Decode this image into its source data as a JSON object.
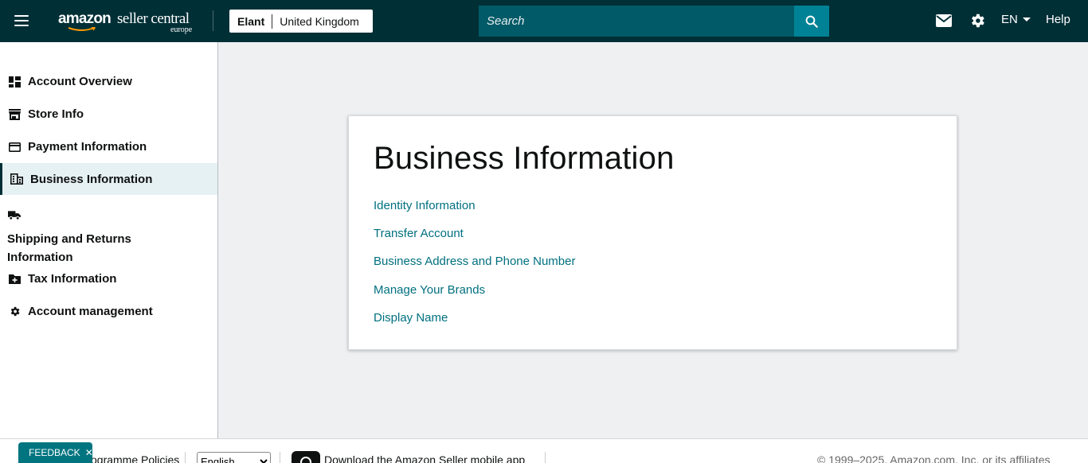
{
  "header": {
    "logo_brand": "amazon",
    "logo_product": "seller central",
    "logo_region": "europe",
    "account_name": "Elant",
    "account_country": "United Kingdom",
    "search_placeholder": "Search",
    "language": "EN",
    "help": "Help",
    "icons": [
      "menu-icon",
      "search-icon",
      "mail-icon",
      "gear-icon"
    ]
  },
  "sidebar": {
    "items": [
      {
        "label": "Account Overview",
        "icon": "dashboard-icon"
      },
      {
        "label": "Store Info",
        "icon": "storefront-icon"
      },
      {
        "label": "Payment Information",
        "icon": "credit-card-icon"
      },
      {
        "label": "Business Information",
        "icon": "building-icon",
        "active": true
      },
      {
        "label": "Shipping and Returns Information",
        "icon": "truck-icon"
      },
      {
        "label": "Tax Information",
        "icon": "tax-folder-icon"
      },
      {
        "label": "Account management",
        "icon": "gear-icon"
      }
    ]
  },
  "main": {
    "title": "Business Information",
    "links": [
      "Identity Information",
      "Transfer Account",
      "Business Address and Phone Number",
      "Manage Your Brands",
      "Display Name"
    ]
  },
  "footer": {
    "policies": "Programme Policies",
    "language_select": "English",
    "app_link": "Download the Amazon Seller mobile app",
    "copyright": "© 1999–2025, Amazon.com, Inc. or its affiliates"
  },
  "feedback": {
    "label": "FEEDBACK",
    "close": "✕"
  },
  "colors": {
    "header_bg": "#002f36",
    "search_bg": "#005a67",
    "search_button": "#008296",
    "link": "#00707f",
    "active_nav_bg": "#e6f1f3",
    "page_bg": "#eff0f2",
    "feedback_bg": "#007580"
  }
}
